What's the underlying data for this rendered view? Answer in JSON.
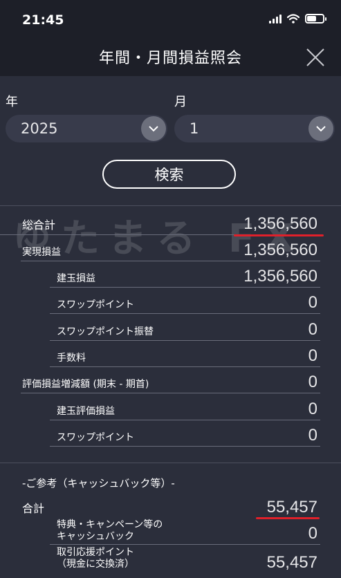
{
  "status_bar": {
    "time": "21:45"
  },
  "header": {
    "title": "年間・月間損益照会"
  },
  "filters": {
    "year_label": "年",
    "year_value": "2025",
    "month_label": "月",
    "month_value": "1"
  },
  "search_button": "検索",
  "watermark": "ゆたまる FX",
  "rows": [
    {
      "label": "総合計",
      "value": "1,356,560"
    },
    {
      "label": "実現損益",
      "value": "1,356,560"
    },
    {
      "label": "建玉損益",
      "value": "1,356,560"
    },
    {
      "label": "スワップポイント",
      "value": "0"
    },
    {
      "label": "スワップポイント振替",
      "value": "0"
    },
    {
      "label": "手数料",
      "value": "0"
    },
    {
      "label": "評価損益増減額 (期末 - 期首)",
      "value": "0"
    },
    {
      "label": "建玉評価損益",
      "value": "0"
    },
    {
      "label": "スワップポイント",
      "value": "0"
    }
  ],
  "reference": {
    "heading": "-ご参考（キャッシュバック等）-",
    "total_label": "合計",
    "total_value": "55,457",
    "campaign_label_1": "特典・キャンペーン等の",
    "campaign_label_2": "キャッシュバック",
    "campaign_value": "0",
    "points_label_1": "取引応援ポイント",
    "points_label_2": "（現金に交換済）",
    "points_value": "55,457"
  },
  "colors": {
    "background": "#2b2e3b",
    "header": "#1d1f28",
    "highlight_underline": "#e0202a"
  }
}
